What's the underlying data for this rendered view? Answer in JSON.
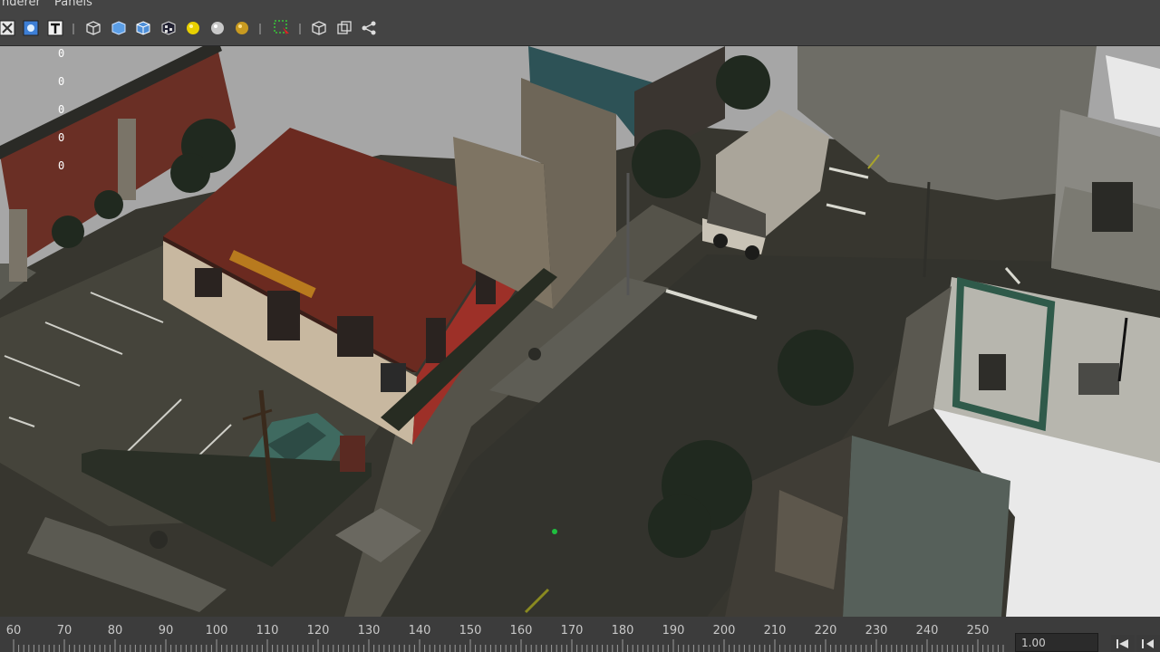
{
  "menu": {
    "items": [
      "nderer",
      "Panels"
    ]
  },
  "toolbar": {
    "icons": [
      "grid-off-icon",
      "snap-icon",
      "text-icon",
      "wireframe-cube-icon",
      "shaded-cube-icon",
      "textured-cube-icon",
      "checker-cube-icon",
      "yellow-light-icon",
      "default-light-icon",
      "gold-light-icon",
      "select-camera-icon",
      "isolate-cube-icon",
      "xray-icon",
      "hierarchy-icon"
    ]
  },
  "viewport": {
    "hud_values": [
      "0",
      "0",
      "0",
      "0",
      "0"
    ]
  },
  "timeline": {
    "ticks": [
      "60",
      "70",
      "80",
      "90",
      "100",
      "110",
      "120",
      "130",
      "140",
      "150",
      "160",
      "170",
      "180",
      "190",
      "200",
      "210",
      "220",
      "230",
      "240",
      "250"
    ],
    "range_value": "1.00"
  },
  "colors": {
    "ui_bg": "#444444",
    "timeline_bg": "#3c3c3c",
    "accent_red": "#cc2222"
  }
}
